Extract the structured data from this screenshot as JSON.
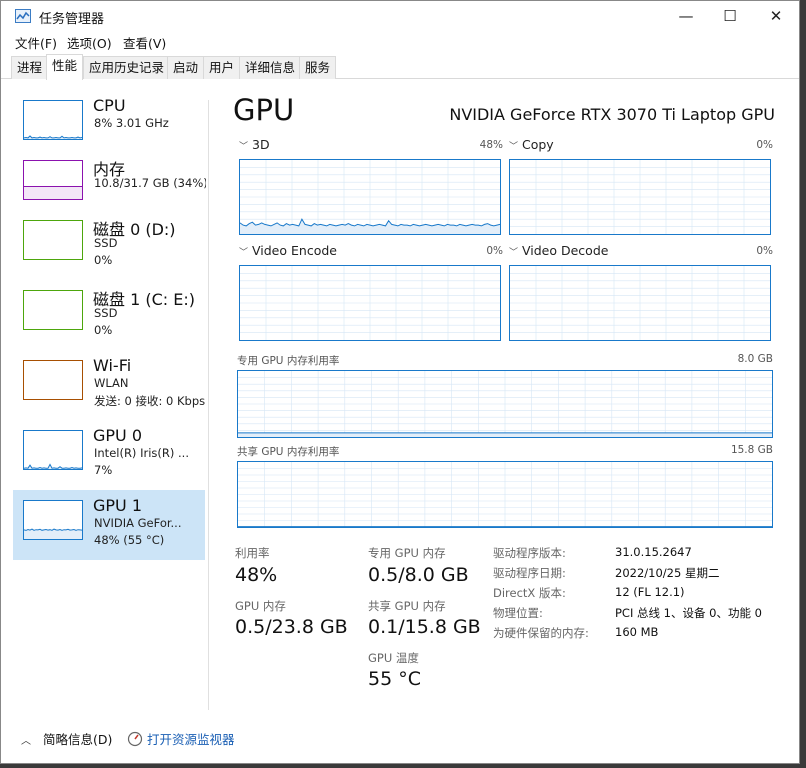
{
  "window": {
    "title": "任务管理器",
    "minimize_glyph": "—",
    "maximize_glyph": "☐",
    "close_glyph": "✕"
  },
  "menu": [
    "文件(F)",
    "选项(O)",
    "查看(V)"
  ],
  "tabs": [
    "进程",
    "性能",
    "应用历史记录",
    "启动",
    "用户",
    "详细信息",
    "服务"
  ],
  "active_tab": "性能",
  "sidebar": [
    {
      "title": "CPU",
      "line1": "8% 3.01 GHz",
      "line2": "",
      "color": "#1979ca"
    },
    {
      "title": "内存",
      "line1": "10.8/31.7 GB (34%)",
      "line2": "",
      "color": "#8b12ae"
    },
    {
      "title": "磁盘 0 (D:)",
      "line1": "SSD",
      "line2": "0%",
      "color": "#4da60c"
    },
    {
      "title": "磁盘 1 (C: E:)",
      "line1": "SSD",
      "line2": "0%",
      "color": "#4da60c"
    },
    {
      "title": "Wi-Fi",
      "line1": "WLAN",
      "line2": "发送: 0 接收: 0 Kbps",
      "color": "#a74f01"
    },
    {
      "title": "GPU 0",
      "line1": "Intel(R) Iris(R) ...",
      "line2": "7%",
      "color": "#1979ca"
    },
    {
      "title": "GPU 1",
      "line1": "NVIDIA GeFor...",
      "line2": "48% (55 °C)",
      "color": "#1979ca"
    }
  ],
  "main": {
    "title": "GPU",
    "gpu_name": "NVIDIA GeForce RTX 3070 Ti Laptop GPU",
    "engines": [
      {
        "label": "3D",
        "pct": "48%"
      },
      {
        "label": "Copy",
        "pct": "0%"
      },
      {
        "label": "Video Encode",
        "pct": "0%"
      },
      {
        "label": "Video Decode",
        "pct": "0%"
      }
    ],
    "dedicated_label": "专用 GPU 内存利用率",
    "dedicated_max": "8.0 GB",
    "shared_label": "共享 GPU 内存利用率",
    "shared_max": "15.8 GB"
  },
  "stats": {
    "utilization_label": "利用率",
    "utilization_value": "48%",
    "dedicated_mem_label": "专用 GPU 内存",
    "dedicated_mem_value": "0.5/8.0 GB",
    "gpu_mem_label": "GPU 内存",
    "gpu_mem_value": "0.5/23.8 GB",
    "shared_mem_label": "共享 GPU 内存",
    "shared_mem_value": "0.1/15.8 GB",
    "temp_label": "GPU 温度",
    "temp_value": "55 °C"
  },
  "info": [
    {
      "label": "驱动程序版本:",
      "value": "31.0.15.2647"
    },
    {
      "label": "驱动程序日期:",
      "value": "2022/10/25 星期二"
    },
    {
      "label": "DirectX 版本:",
      "value": "12 (FL 12.1)"
    },
    {
      "label": "物理位置:",
      "value": "PCI 总线 1、设备 0、功能 0"
    },
    {
      "label": "为硬件保留的内存:",
      "value": "160 MB"
    }
  ],
  "footer": {
    "summary_label": "简略信息(D)",
    "monitor_label": "打开资源监视器"
  },
  "colors": {
    "accent": "#1979ca",
    "selected_bg": "#cce4f7",
    "memory": "#8b12ae",
    "disk": "#4da60c",
    "wifi": "#a74f01"
  },
  "series": {
    "gpu3d": [
      15,
      12,
      11,
      14,
      16,
      12,
      13,
      15,
      13,
      12,
      11,
      13,
      15,
      12,
      11,
      14,
      12,
      13,
      12,
      11,
      20,
      13,
      12,
      11,
      14,
      12,
      13,
      12,
      11,
      13,
      12,
      11,
      12,
      13,
      12,
      14,
      12,
      11,
      13,
      12,
      11,
      13,
      12,
      11,
      12,
      13,
      12,
      11,
      18,
      13,
      12,
      11,
      13,
      12,
      12,
      11,
      13,
      12,
      11,
      12,
      13,
      12,
      11,
      12,
      13,
      12,
      11,
      13,
      12,
      12,
      11,
      13,
      12,
      11,
      12,
      13,
      12,
      12,
      11,
      13,
      14,
      12,
      11,
      12,
      13
    ],
    "cpu_thumb": [
      3,
      4,
      3,
      8,
      3,
      4,
      3,
      3,
      5,
      3,
      4,
      3,
      3,
      6,
      3,
      3,
      4,
      3,
      3,
      7,
      3,
      4,
      3,
      3,
      4,
      3,
      3,
      5,
      3,
      4
    ],
    "gpu0_thumb": [
      2,
      3,
      2,
      10,
      2,
      3,
      2,
      2,
      4,
      2,
      3,
      2,
      2,
      12,
      2,
      3,
      2,
      2,
      6,
      2,
      2,
      3,
      2,
      2,
      4,
      2,
      3,
      2,
      2,
      3
    ],
    "gpu1_thumb": [
      48,
      45,
      50,
      47,
      52,
      46,
      49,
      48,
      51,
      46,
      48,
      50,
      47,
      49,
      46,
      52,
      48,
      47,
      50,
      46,
      49,
      48,
      51,
      47,
      48,
      50,
      46,
      49,
      48,
      47
    ]
  }
}
